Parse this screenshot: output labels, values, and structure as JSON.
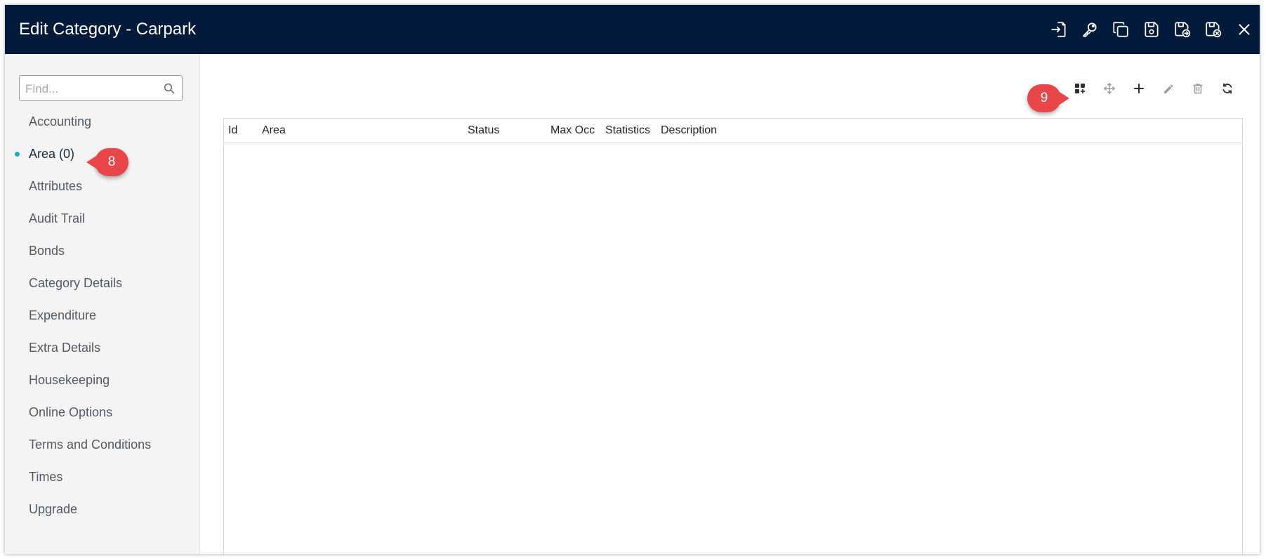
{
  "window": {
    "title": "Edit Category - Carpark",
    "actions": [
      {
        "icon": "sign-in-icon"
      },
      {
        "icon": "key-icon"
      },
      {
        "icon": "copy-icon"
      },
      {
        "icon": "save-icon"
      },
      {
        "icon": "save-and-new-icon"
      },
      {
        "icon": "save-and-close-icon"
      },
      {
        "icon": "close-icon"
      }
    ]
  },
  "sidebar": {
    "search": {
      "placeholder": "Find...",
      "value": ""
    },
    "items": [
      {
        "label": "Accounting"
      },
      {
        "label": "Area (0)",
        "active": true
      },
      {
        "label": "Attributes"
      },
      {
        "label": "Audit Trail"
      },
      {
        "label": "Bonds"
      },
      {
        "label": "Category Details"
      },
      {
        "label": "Expenditure"
      },
      {
        "label": "Extra Details"
      },
      {
        "label": "Housekeeping"
      },
      {
        "label": "Online Options"
      },
      {
        "label": "Terms and Conditions"
      },
      {
        "label": "Times"
      },
      {
        "label": "Upgrade"
      }
    ]
  },
  "callouts": {
    "area": "8",
    "toolbar": "9"
  },
  "toolbar": {
    "icons": [
      "add-multiple-icon",
      "move-icon",
      "add-icon",
      "edit-icon",
      "delete-icon",
      "refresh-icon"
    ]
  },
  "grid": {
    "columns": [
      "Id",
      "Area",
      "Status",
      "Max Occ",
      "Statistics",
      "Description"
    ],
    "rows": []
  },
  "colors": {
    "titlebar": "#011a3a",
    "active_dot": "#16b2c2",
    "callout": "#e84649"
  }
}
